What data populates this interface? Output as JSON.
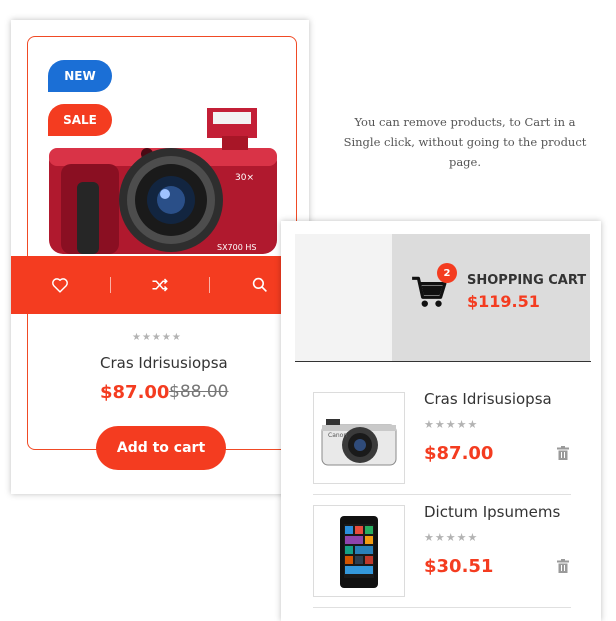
{
  "product_card": {
    "badges": {
      "new": "NEW",
      "sale": "SALE"
    },
    "name": "Cras Idrisusiopsa",
    "rating": "★★★★★",
    "price": "$87.00",
    "old_price": "$88.00",
    "add_to_cart_label": "Add to cart",
    "actions": [
      "heart-icon",
      "shuffle-icon",
      "search-icon"
    ]
  },
  "description": "You can remove products, to Cart in a Single click, without going to the product page.",
  "mini_cart": {
    "title": "SHOPPING CART",
    "total": "$119.51",
    "count": "2",
    "items": [
      {
        "name": "Cras Idrisusiopsa",
        "rating": "★★★★★",
        "price": "$87.00"
      },
      {
        "name": "Dictum Ipsumems",
        "rating": "★★★★★",
        "price": "$30.51"
      }
    ]
  },
  "colors": {
    "accent": "#f43c20",
    "new_badge": "#1b6fd6"
  }
}
